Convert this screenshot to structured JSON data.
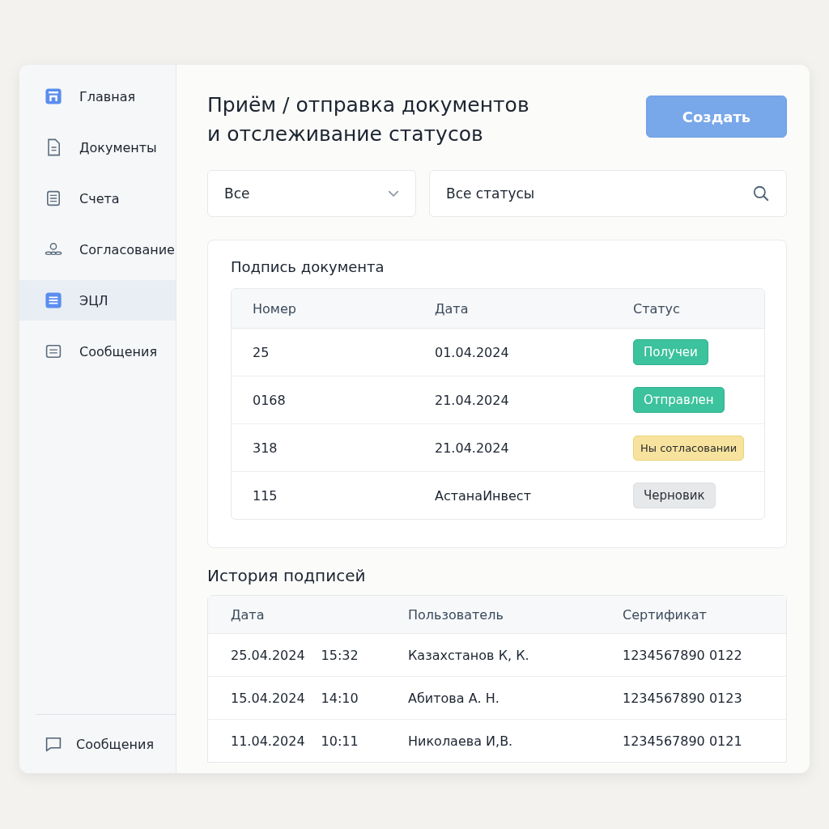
{
  "sidebar": {
    "items": [
      {
        "label": "Главная",
        "selected": false
      },
      {
        "label": "Документы",
        "selected": false
      },
      {
        "label": "Счета",
        "selected": false
      },
      {
        "label": "Согласование",
        "selected": false
      },
      {
        "label": "ЭЦЛ",
        "selected": true
      },
      {
        "label": "Сообщения",
        "selected": false
      }
    ],
    "footer_item": {
      "label": "Сообщения"
    }
  },
  "header": {
    "title": "Приём / отправка документов и отслеживание статусов",
    "create_button": "Создать"
  },
  "filters": {
    "type_select": {
      "value": "Все"
    },
    "status_search": {
      "value": "Все статусы"
    }
  },
  "signature_card": {
    "title": "Подпись документа",
    "columns": [
      "Номер",
      "Дата",
      "Статус"
    ],
    "rows": [
      {
        "number": "25",
        "date": "01.04.2024",
        "status": {
          "label": "Получеи",
          "kind": "success"
        }
      },
      {
        "number": "0168",
        "date": "21.04.2024",
        "status": {
          "label": "Отправлен",
          "kind": "success"
        }
      },
      {
        "number": "318",
        "date": "21.04.2024",
        "status": {
          "label": "Ны сотласовании",
          "kind": "pending"
        }
      },
      {
        "number": "115",
        "date": "АстанаИнвест",
        "status": {
          "label": "Черновик",
          "kind": "draft"
        }
      }
    ]
  },
  "history": {
    "title": "История подписей",
    "columns": [
      "Дата",
      "Пользователь",
      "Сертификат"
    ],
    "rows": [
      {
        "date": "25.04.2024",
        "time": "15:32",
        "user": "Казахстанов К, К.",
        "certificate": "1234567890 0122"
      },
      {
        "date": "15.04.2024",
        "time": "14:10",
        "user": "Абитова А. Н.",
        "certificate": "1234567890 0123"
      },
      {
        "date": "11.04.2024",
        "time": "10:11",
        "user": "Николаева И,В.",
        "certificate": "1234567890 0121"
      }
    ]
  }
}
